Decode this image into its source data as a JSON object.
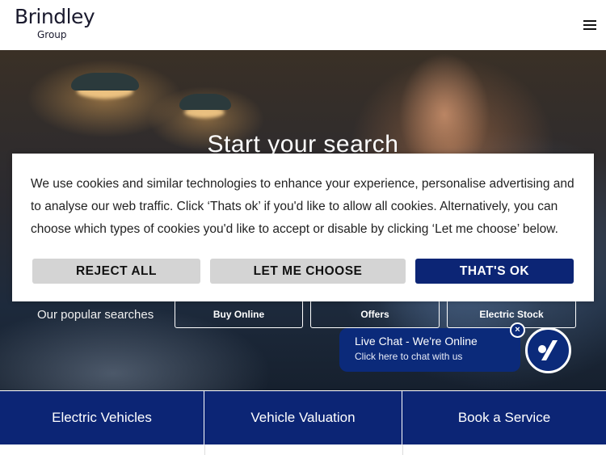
{
  "header": {
    "logo_main": "Brindley",
    "logo_sub": "Group",
    "menu_icon": "hamburger-menu-icon"
  },
  "hero": {
    "title": "Start your search",
    "popular_label": "Our popular searches",
    "popular_searches": [
      "Buy Online",
      "Offers",
      "Electric Stock"
    ]
  },
  "cookie_banner": {
    "text": "We use cookies and similar technologies to enhance your experience, personalise advertising and to analyse our web traffic. Click ‘Thats ok’ if you'd like to allow all cookies. Alternatively, you can choose which types of cookies you'd like to accept or disable by clicking ‘Let me choose’ below.",
    "reject_label": "REJECT ALL",
    "choose_label": "LET ME CHOOSE",
    "accept_label": "THAT'S OK"
  },
  "live_chat": {
    "title": "Live Chat - We're Online",
    "subtitle": "Click here to chat with us",
    "close_label": "×",
    "avatar_icon": "brindley-chat-logo-icon"
  },
  "tiles": [
    "Electric Vehicles",
    "Vehicle Valuation",
    "Book a Service"
  ],
  "colors": {
    "brand_blue": "#0c2575",
    "chat_blue": "#0b2a7a",
    "button_grey": "#d4d4d4"
  }
}
